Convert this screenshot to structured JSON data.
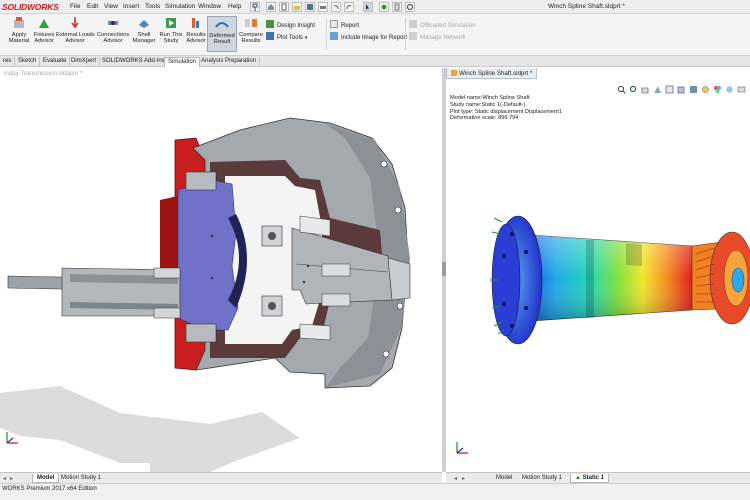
{
  "app": {
    "logo_text": "SOLIDWORKS",
    "document_title": "Winch Spline Shaft.sldprt *",
    "menu": [
      "File",
      "Edit",
      "View",
      "Insert",
      "Tools",
      "Simulation",
      "Window",
      "Help"
    ]
  },
  "ribbon": {
    "buttons": [
      {
        "label": "Apply\nMaterial",
        "icon": "apply-material-icon"
      },
      {
        "label": "Fixtures\nAdvisor",
        "icon": "fixtures-advisor-icon"
      },
      {
        "label": "External Loads\nAdvisor",
        "icon": "external-loads-icon"
      },
      {
        "label": "Connections\nAdvisor",
        "icon": "connections-advisor-icon"
      },
      {
        "label": "Shell\nManager",
        "icon": "shell-manager-icon"
      },
      {
        "label": "Run This\nStudy",
        "icon": "run-study-icon"
      },
      {
        "label": "Results\nAdvisor",
        "icon": "results-advisor-icon"
      },
      {
        "label": "Deformed\nResult",
        "icon": "deformed-result-icon",
        "active": true
      },
      {
        "label": "Compare\nResults",
        "icon": "compare-results-icon"
      }
    ],
    "small": [
      {
        "label": "Design Insight",
        "icon": "design-insight-icon"
      },
      {
        "label": "Plot Tools",
        "icon": "plot-tools-icon"
      },
      {
        "label": "Report",
        "icon": "report-icon"
      },
      {
        "label": "Include Image for Report",
        "icon": "include-image-icon"
      },
      {
        "label": "Offloaded Simulation",
        "icon": "offloaded-simulation-icon",
        "disabled": true
      },
      {
        "label": "Manage Network",
        "icon": "manage-network-icon",
        "disabled": true
      }
    ]
  },
  "tabs": [
    "res",
    "Sketch",
    "Evaluate",
    "DimXpert",
    "SOLIDWORKS Add-Ins",
    "Simulation",
    "Analysis Preparation"
  ],
  "active_tab": "Simulation",
  "left_view": {
    "doc_tab": "inday Transmission.sldasm *"
  },
  "right_view": {
    "doc_tab": "Winch Spline Shaft.sldprt *",
    "plot_info": [
      "Model name:Winch Spline Shaft",
      "Study name:Static 1(-Default-)",
      "Plot type: Static displacement Displacement1",
      "Deformation scale: 896.794"
    ]
  },
  "bottom_left_tabs": [
    "Model",
    "Motion Study 1"
  ],
  "bottom_right_tabs": [
    "Model",
    "Motion Study 1",
    "Static 1"
  ],
  "bottom_right_active": "Static 1",
  "status_text": "WORKS Premium 2017 x64 Edition",
  "colors": {
    "accent_red": "#d4191c",
    "section_red": "#cc1f1f",
    "section_blue": "#6d71c9",
    "steel_gray": "#a7acb1"
  }
}
